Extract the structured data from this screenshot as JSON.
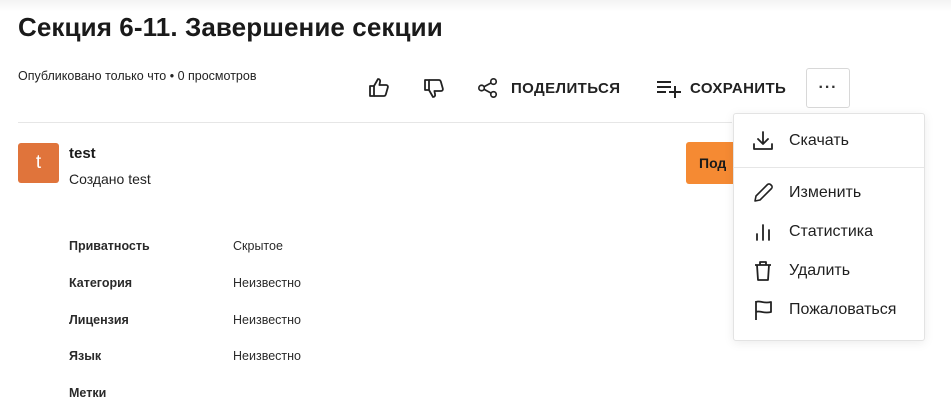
{
  "page": {
    "title": "Секция 6-11. Завершение секции",
    "meta": "Опубликовано только что • 0 просмотров"
  },
  "actions": {
    "like_icon": "thumbs-up-icon",
    "dislike_icon": "thumbs-down-icon",
    "share_label": "ПОДЕЛИТЬСЯ",
    "save_label": "СОХРАНИТЬ",
    "more_label": "···"
  },
  "author": {
    "avatar_letter": "t",
    "avatar_color": "#e0743b",
    "name": "test",
    "created_by": "Создано test",
    "subscribe_label": "Под"
  },
  "details": [
    {
      "label": "Приватность",
      "value": "Скрытое"
    },
    {
      "label": "Категория",
      "value": "Неизвестно"
    },
    {
      "label": "Лицензия",
      "value": "Неизвестно"
    },
    {
      "label": "Язык",
      "value": "Неизвестно"
    },
    {
      "label": "Метки",
      "value": ""
    }
  ],
  "menu": {
    "items": [
      {
        "label": "Скачать",
        "icon": "download-icon"
      },
      {
        "label": "Изменить",
        "icon": "pencil-icon"
      },
      {
        "label": "Статистика",
        "icon": "stats-icon"
      },
      {
        "label": "Удалить",
        "icon": "trash-icon"
      },
      {
        "label": "Пожаловаться",
        "icon": "flag-icon"
      }
    ]
  },
  "colors": {
    "accent": "#f58a33",
    "avatar": "#e0743b"
  }
}
